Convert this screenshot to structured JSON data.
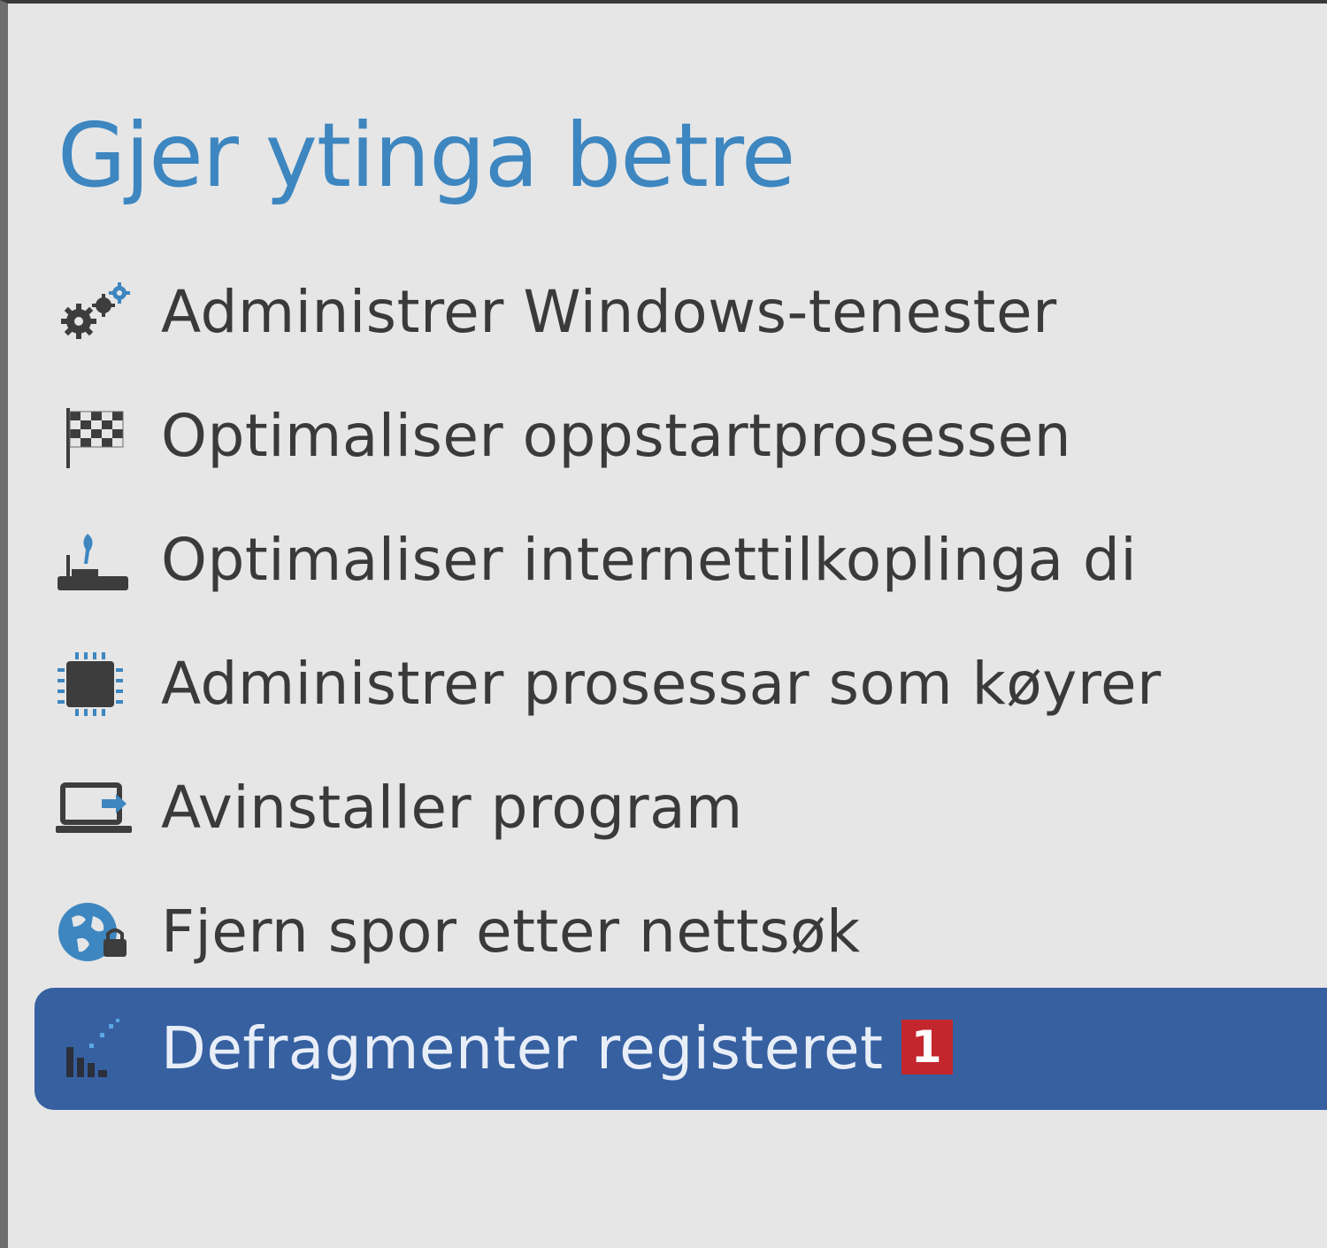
{
  "section": {
    "title": "Gjer ytinga betre"
  },
  "menu": {
    "items": [
      {
        "label": "Administrer Windows-tenester",
        "icon": "gears-icon"
      },
      {
        "label": "Optimaliser oppstartprosessen",
        "icon": "checkered-flag-icon"
      },
      {
        "label": "Optimaliser internettilkoplinga di",
        "icon": "router-icon"
      },
      {
        "label": "Administrer prosessar som køyrer",
        "icon": "cpu-chip-icon"
      },
      {
        "label": "Avinstaller program",
        "icon": "laptop-uninstall-icon"
      },
      {
        "label": "Fjern spor etter nettsøk",
        "icon": "globe-lock-icon"
      },
      {
        "label": "Defragmenter registeret",
        "icon": "registry-defrag-icon",
        "badge": "1",
        "selected": true
      }
    ]
  },
  "colors": {
    "title": "#3d86c0",
    "selected_background": "#3660a0",
    "badge": "#c4262e",
    "panel_background": "#e6e6e6"
  }
}
